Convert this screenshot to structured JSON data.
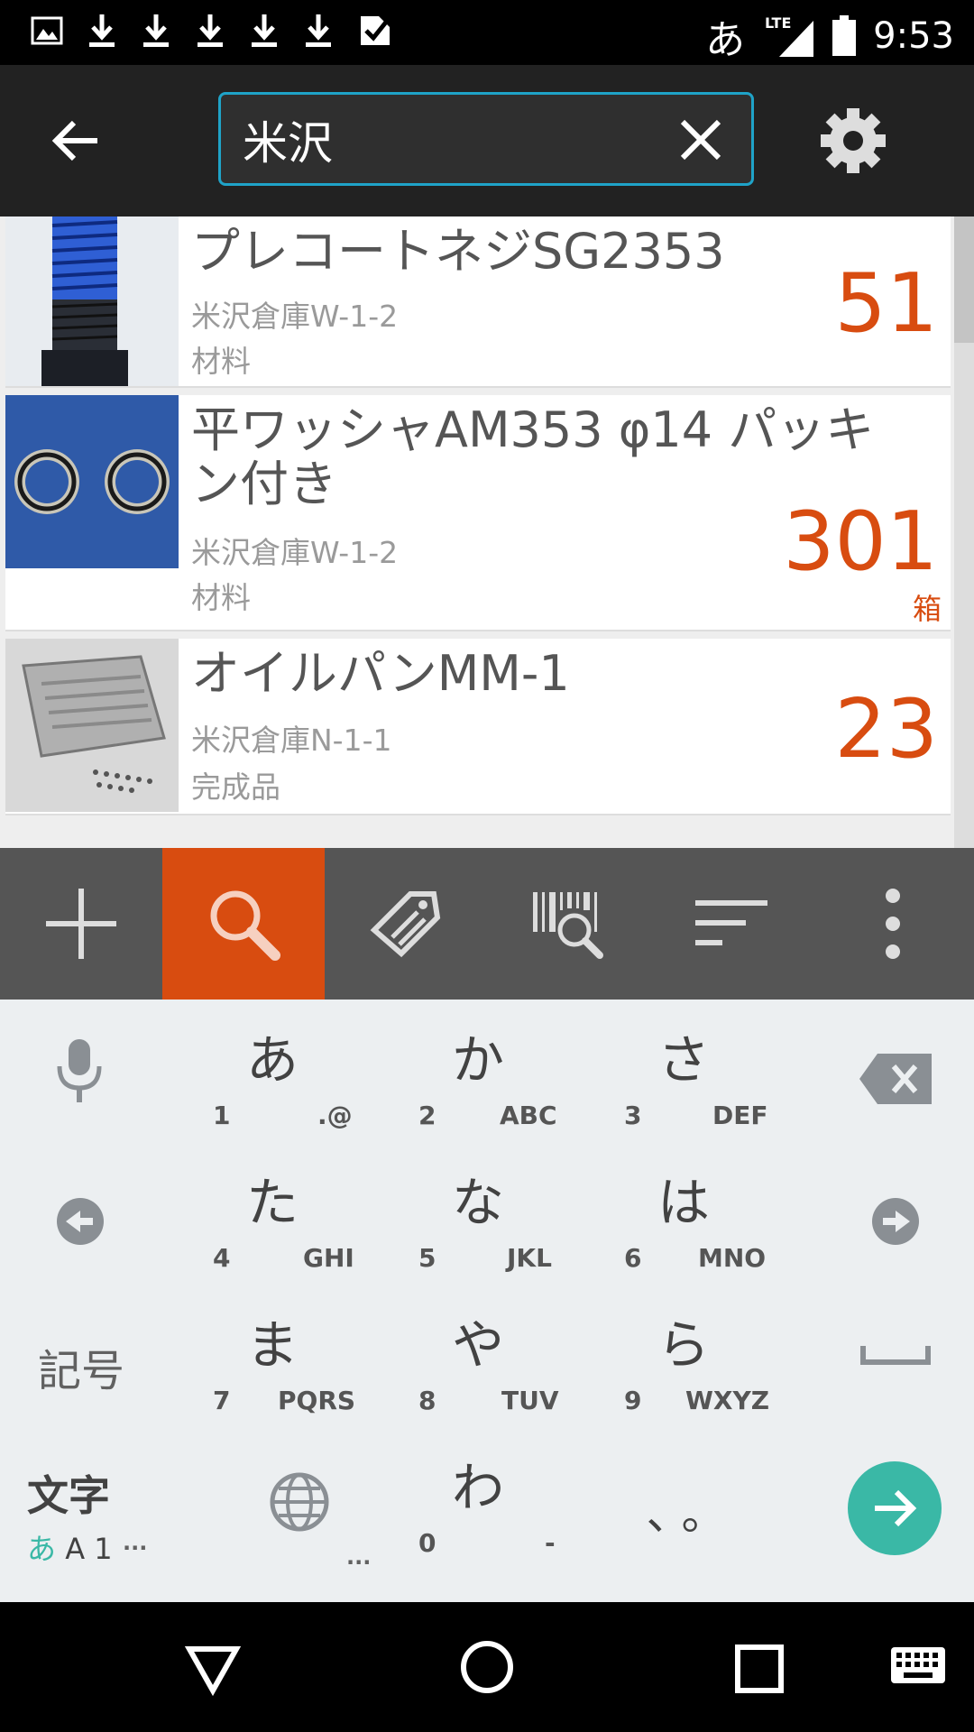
{
  "status_bar": {
    "ime": "あ",
    "network": "LTE",
    "time": "9:53"
  },
  "search": {
    "value": "米沢",
    "placeholder": ""
  },
  "items": [
    {
      "title": "プレコートネジSG2353",
      "location": "米沢倉庫W-1-2",
      "category": "材料",
      "quantity": "51",
      "unit": ""
    },
    {
      "title_line1": "平ワッシャAM353 φ14 パッキ",
      "title_line2": "ン付き",
      "location": "米沢倉庫W-1-2",
      "category": "材料",
      "quantity": "301",
      "unit": "箱"
    },
    {
      "title": "オイルパンMM-1",
      "location": "米沢倉庫N-1-1",
      "category": "完成品",
      "quantity": "23",
      "unit": ""
    }
  ],
  "toolbar": [
    "add-icon",
    "search-icon",
    "edit-tag-icon",
    "barcode-search-icon",
    "sort-icon",
    "more-icon"
  ],
  "keyboard": {
    "row1": [
      {
        "kana": "あ",
        "num": "1",
        "alpha": ".@"
      },
      {
        "kana": "か",
        "num": "2",
        "alpha": "ABC"
      },
      {
        "kana": "さ",
        "num": "3",
        "alpha": "DEF"
      }
    ],
    "row2": [
      {
        "kana": "た",
        "num": "4",
        "alpha": "GHI"
      },
      {
        "kana": "な",
        "num": "5",
        "alpha": "JKL"
      },
      {
        "kana": "は",
        "num": "6",
        "alpha": "MNO"
      }
    ],
    "row3": [
      {
        "kana": "ま",
        "num": "7",
        "alpha": "PQRS"
      },
      {
        "kana": "や",
        "num": "8",
        "alpha": "TUV"
      },
      {
        "kana": "ら",
        "num": "9",
        "alpha": "WXYZ"
      }
    ],
    "symbols_label": "記号",
    "mode_label": "文字",
    "mode_sub_kana": "あ",
    "mode_sub_latin": "A 1",
    "ellipsis": "...",
    "wa_key": {
      "kana": "わ",
      "num": "0",
      "alpha": "-"
    },
    "punct_key": "、。"
  },
  "colors": {
    "accent": "#d84c10",
    "search_border": "#1fa3c8",
    "enter": "#3ab8a6"
  }
}
